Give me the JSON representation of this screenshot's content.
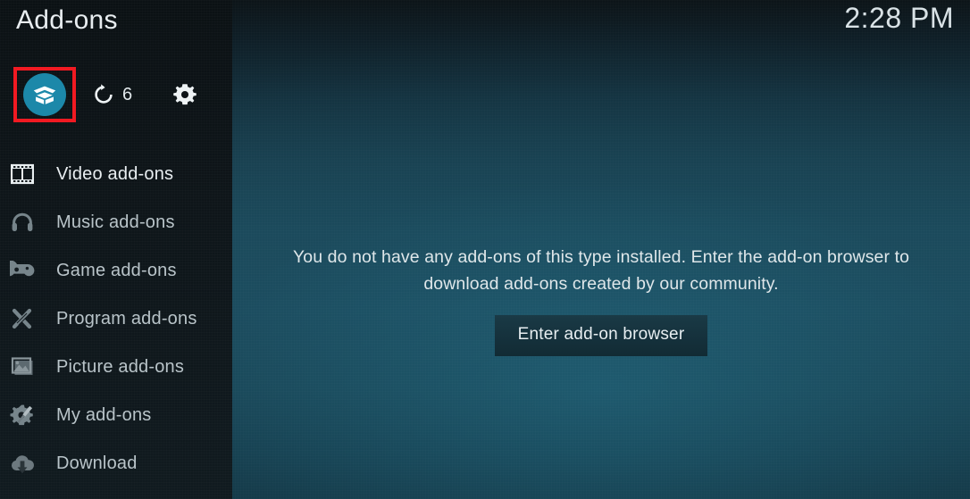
{
  "window": {
    "title": "Add-ons",
    "clock": "2:28 PM"
  },
  "toolbar": {
    "addons_button_label": "Add-ons",
    "addons_icon": "open-box-icon",
    "refresh_icon": "refresh-icon",
    "refresh_label": "Refresh",
    "update_count": "6",
    "settings_icon": "gear-icon",
    "settings_label": "Settings",
    "highlight_color": "#f11a22",
    "accent_color": "#1c88a9"
  },
  "sidebar": {
    "items": [
      {
        "label": "Video add-ons",
        "icon": "film-strip-icon",
        "active": true
      },
      {
        "label": "Music add-ons",
        "icon": "headphones-icon",
        "active": false
      },
      {
        "label": "Game add-ons",
        "icon": "gamepad-icon",
        "active": false
      },
      {
        "label": "Program add-ons",
        "icon": "crossed-tools-icon",
        "active": false
      },
      {
        "label": "Picture add-ons",
        "icon": "photos-icon",
        "active": false
      },
      {
        "label": "My add-ons",
        "icon": "gear-screwdriver-icon",
        "active": false
      },
      {
        "label": "Download",
        "icon": "cloud-download-icon",
        "active": false
      }
    ]
  },
  "main": {
    "empty_message": "You do not have any add-ons of this type installed. Enter the add-on browser to download add-ons created by our community.",
    "browser_button_label": "Enter add-on browser"
  }
}
